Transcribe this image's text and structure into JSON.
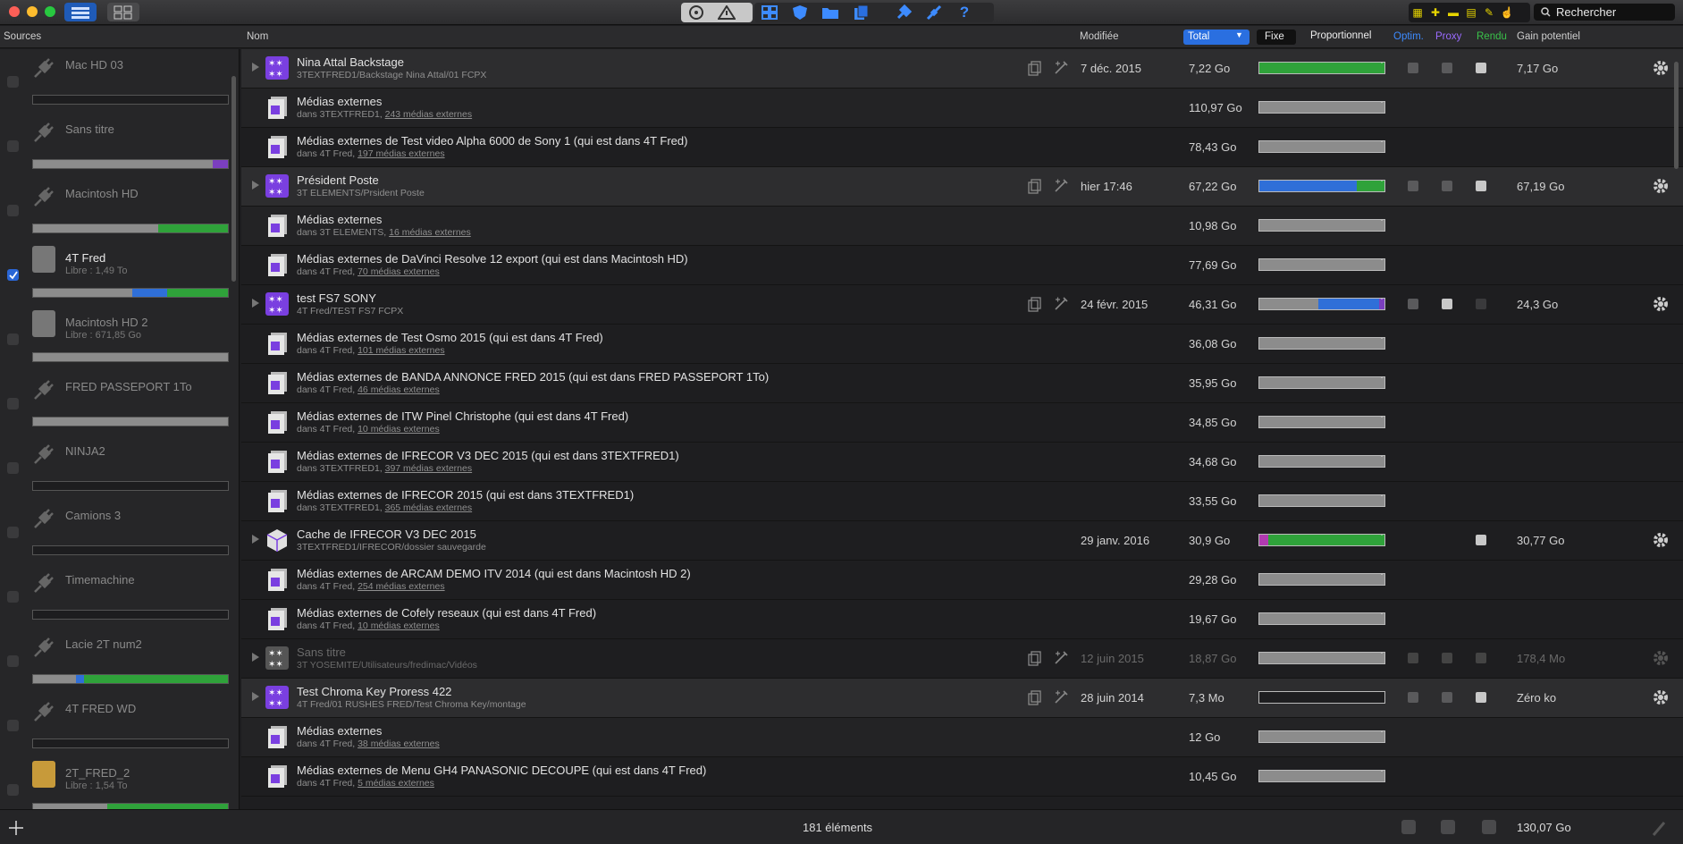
{
  "search": {
    "placeholder": "Rechercher"
  },
  "columns": {
    "sources": "Sources",
    "name": "Nom",
    "modified": "Modifiée",
    "total": "Total",
    "fixe": "Fixe",
    "proportionnel": "Proportionnel",
    "optim": "Optim.",
    "proxy": "Proxy",
    "rendu": "Rendu",
    "gain": "Gain potentiel"
  },
  "colors": {
    "green": "#2fa23a",
    "blue": "#2f6fd8",
    "purple": "#7b3fbf",
    "grey": "#8c8c8c",
    "magenta": "#b03ab0"
  },
  "sources": [
    {
      "name": "Mac HD 03",
      "sub": "",
      "checked": false,
      "usage": []
    },
    {
      "name": "Sans titre",
      "sub": "",
      "checked": false,
      "usage": [
        {
          "color": "grey",
          "pct": 92
        },
        {
          "color": "purple",
          "pct": 8
        }
      ]
    },
    {
      "name": "Macintosh HD",
      "sub": "",
      "checked": false,
      "usage": [
        {
          "color": "grey",
          "pct": 64
        },
        {
          "color": "green",
          "pct": 36
        }
      ]
    },
    {
      "name": "4T Fred",
      "sub": "Libre : 1,49 To",
      "checked": true,
      "usage": [
        {
          "color": "grey",
          "pct": 51
        },
        {
          "color": "blue",
          "pct": 18
        },
        {
          "color": "green",
          "pct": 31
        }
      ]
    },
    {
      "name": "Macintosh HD 2",
      "sub": "Libre : 671,85 Go",
      "checked": false,
      "usage": [
        {
          "color": "grey",
          "pct": 100
        }
      ]
    },
    {
      "name": "FRED PASSEPORT 1To",
      "sub": "",
      "checked": false,
      "usage": [
        {
          "color": "grey",
          "pct": 100
        }
      ]
    },
    {
      "name": "NINJA2",
      "sub": "",
      "checked": false,
      "usage": []
    },
    {
      "name": "Camions 3",
      "sub": "",
      "checked": false,
      "usage": []
    },
    {
      "name": "Timemachine",
      "sub": "",
      "checked": false,
      "usage": []
    },
    {
      "name": "Lacie 2T num2",
      "sub": "",
      "checked": false,
      "usage": [
        {
          "color": "grey",
          "pct": 22
        },
        {
          "color": "blue",
          "pct": 4
        },
        {
          "color": "green",
          "pct": 74
        }
      ]
    },
    {
      "name": "4T FRED WD",
      "sub": "",
      "checked": false,
      "usage": []
    },
    {
      "name": "2T_FRED_2",
      "sub": "Libre : 1,54 To",
      "checked": false,
      "usage": [
        {
          "color": "grey",
          "pct": 38
        },
        {
          "color": "green",
          "pct": 62
        }
      ]
    }
  ],
  "rows": [
    {
      "type": "lib",
      "title": "Nina Attal Backstage",
      "path": "3TEXTFRED1/Backstage Nina Attal/01 FCPX",
      "link": "",
      "date": "7 déc. 2015",
      "size": "7,22 Go",
      "bar": [
        {
          "color": "green",
          "pct": 100
        }
      ],
      "gain": "7,17 Go"
    },
    {
      "type": "ext",
      "title": "Médias externes",
      "path": "dans 3TEXTFRED1, ",
      "link": "243 médias externes",
      "date": "",
      "size": "110,97 Go",
      "bar": [
        {
          "color": "grey",
          "pct": 100
        }
      ],
      "gain": ""
    },
    {
      "type": "ext2",
      "title": "Médias externes de Test video Alpha 6000 de Sony 1 (qui est dans 4T Fred)",
      "path": "dans 4T Fred, ",
      "link": "197 médias externes",
      "date": "",
      "size": "78,43 Go",
      "bar": [
        {
          "color": "grey",
          "pct": 100
        }
      ],
      "gain": ""
    },
    {
      "type": "lib",
      "title": "Président Poste",
      "path": "3T ELEMENTS/Prsident Poste",
      "link": "",
      "date": "hier 17:46",
      "size": "67,22 Go",
      "bar": [
        {
          "color": "blue",
          "pct": 78
        },
        {
          "color": "green",
          "pct": 22
        }
      ],
      "gain": "67,19 Go"
    },
    {
      "type": "ext",
      "title": "Médias externes",
      "path": "dans 3T ELEMENTS, ",
      "link": "16 médias externes",
      "date": "",
      "size": "10,98 Go",
      "bar": [
        {
          "color": "grey",
          "pct": 100
        }
      ],
      "gain": ""
    },
    {
      "type": "ext2",
      "title": "Médias externes de DaVinci Resolve 12 export (qui est dans Macintosh HD)",
      "path": "dans 4T Fred, ",
      "link": "70 médias externes",
      "date": "",
      "size": "77,69 Go",
      "bar": [
        {
          "color": "grey",
          "pct": 100
        }
      ],
      "gain": ""
    },
    {
      "type": "lib2",
      "title": "test FS7 SONY",
      "path": "4T Fred/TEST FS7 FCPX",
      "link": "",
      "date": "24 févr. 2015",
      "size": "46,31 Go",
      "bar": [
        {
          "color": "grey",
          "pct": 47
        },
        {
          "color": "blue",
          "pct": 49
        },
        {
          "color": "purple",
          "pct": 4
        }
      ],
      "gain": "24,3 Go"
    },
    {
      "type": "ext2",
      "title": "Médias externes de Test Osmo 2015 (qui est dans 4T Fred)",
      "path": "dans 4T Fred, ",
      "link": "101 médias externes",
      "date": "",
      "size": "36,08 Go",
      "bar": [
        {
          "color": "grey",
          "pct": 100
        }
      ],
      "gain": ""
    },
    {
      "type": "ext2",
      "title": "Médias externes de BANDA ANNONCE FRED 2015 (qui est dans FRED PASSEPORT 1To)",
      "path": "dans 4T Fred, ",
      "link": "46 médias externes",
      "date": "",
      "size": "35,95 Go",
      "bar": [
        {
          "color": "grey",
          "pct": 100
        }
      ],
      "gain": ""
    },
    {
      "type": "ext2",
      "title": "Médias externes de ITW Pinel Christophe (qui est dans 4T Fred)",
      "path": "dans 4T Fred, ",
      "link": "10 médias externes",
      "date": "",
      "size": "34,85 Go",
      "bar": [
        {
          "color": "grey",
          "pct": 100
        }
      ],
      "gain": ""
    },
    {
      "type": "ext2",
      "title": "Médias externes de IFRECOR V3 DEC 2015 (qui est dans 3TEXTFRED1)",
      "path": "dans 3TEXTFRED1, ",
      "link": "397 médias externes",
      "date": "",
      "size": "34,68 Go",
      "bar": [
        {
          "color": "grey",
          "pct": 100
        }
      ],
      "gain": ""
    },
    {
      "type": "ext2",
      "title": "Médias externes de IFRECOR 2015 (qui est dans 3TEXTFRED1)",
      "path": "dans 3TEXTFRED1, ",
      "link": "365 médias externes",
      "date": "",
      "size": "33,55 Go",
      "bar": [
        {
          "color": "grey",
          "pct": 100
        }
      ],
      "gain": ""
    },
    {
      "type": "cache",
      "title": "Cache de IFRECOR V3 DEC 2015",
      "path": "3TEXTFRED1/IFRECOR/dossier sauvegarde",
      "link": "",
      "date": "29 janv. 2016",
      "size": "30,9 Go",
      "bar": [
        {
          "color": "magenta",
          "pct": 7
        },
        {
          "color": "green",
          "pct": 93
        }
      ],
      "gain": "30,77 Go"
    },
    {
      "type": "ext2",
      "title": "Médias externes de ARCAM DEMO ITV 2014 (qui est dans Macintosh HD 2)",
      "path": "dans 4T Fred, ",
      "link": "254 médias externes",
      "date": "",
      "size": "29,28 Go",
      "bar": [
        {
          "color": "grey",
          "pct": 100
        }
      ],
      "gain": ""
    },
    {
      "type": "ext2",
      "title": "Médias externes de Cofely reseaux (qui est dans 4T Fred)",
      "path": "dans 4T Fred, ",
      "link": "10 médias externes",
      "date": "",
      "size": "19,67 Go",
      "bar": [
        {
          "color": "grey",
          "pct": 100
        }
      ],
      "gain": ""
    },
    {
      "type": "dim",
      "title": "Sans titre",
      "path": "3T YOSEMITE/Utilisateurs/fredimac/Vidéos",
      "link": "",
      "date": "12 juin 2015",
      "size": "18,87 Go",
      "bar": [
        {
          "color": "grey",
          "pct": 100
        }
      ],
      "gain": "178,4 Mo"
    },
    {
      "type": "lib",
      "title": "Test Chroma Key Proress 422",
      "path": "4T Fred/01 RUSHES FRED/Test Chroma Key/montage",
      "link": "",
      "date": "28 juin 2014",
      "size": "7,3 Mo",
      "bar": [],
      "gain": "Zéro ko"
    },
    {
      "type": "ext",
      "title": "Médias externes",
      "path": "dans 4T Fred, ",
      "link": "38 médias externes",
      "date": "",
      "size": "12 Go",
      "bar": [
        {
          "color": "grey",
          "pct": 100
        }
      ],
      "gain": ""
    },
    {
      "type": "ext2",
      "title": "Médias externes de Menu GH4 PANASONIC DECOUPE (qui est dans 4T Fred)",
      "path": "dans 4T Fred, ",
      "link": "5 médias externes",
      "date": "",
      "size": "10,45 Go",
      "bar": [
        {
          "color": "grey",
          "pct": 100
        }
      ],
      "gain": ""
    }
  ],
  "footer": {
    "count": "181 éléments",
    "total": "130,07 Go"
  }
}
